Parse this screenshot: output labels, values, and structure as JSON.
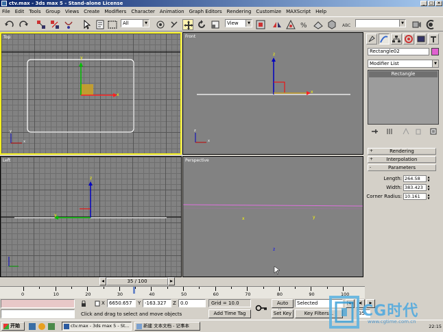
{
  "window": {
    "title": "ctv.max - 3ds max 5 - Stand-alone License"
  },
  "menu": [
    "File",
    "Edit",
    "Tools",
    "Group",
    "Views",
    "Create",
    "Modifiers",
    "Character",
    "Animation",
    "Graph Editors",
    "Rendering",
    "Customize",
    "MAXScript",
    "Help"
  ],
  "toolbar": {
    "selection_filter": "All",
    "ref_coord": "View",
    "named_selection": ""
  },
  "viewports": {
    "top": "Top",
    "front": "Front",
    "left": "Left",
    "perspective": "Perspective"
  },
  "axes": {
    "x": "x",
    "y": "y",
    "z": "z"
  },
  "command_panel": {
    "object_name": "Rectangle02",
    "object_color": "#e060d0",
    "modifier_list": "Modifier List",
    "stack_item": "Rectangle",
    "rollouts": [
      "Rendering",
      "Interpolation",
      "Parameters"
    ],
    "rollout_signs": [
      "+",
      "+",
      "-"
    ],
    "params": {
      "length_label": "Length:",
      "length": "264.58",
      "width_label": "Width:",
      "width": "383.423",
      "corner_label": "Corner Radius:",
      "corner": "10.161"
    }
  },
  "timeline": {
    "slider": "35 / 100",
    "ticks": [
      "0",
      "10",
      "20",
      "30",
      "40",
      "50",
      "60",
      "70",
      "80",
      "90",
      "100"
    ]
  },
  "status": {
    "coords": {
      "x_label": "X",
      "x": "6650.657",
      "y_label": "Y",
      "y": "-163.327",
      "z_label": "Z",
      "z": "0.0"
    },
    "grid": "Grid = 10.0",
    "prompt": "Click and drag to select and move objects",
    "add_time_tag": "Add Time Tag",
    "auto_key": "Auto Key",
    "set_key": "Set Key",
    "key_mode": "Selected",
    "key_filters": "Key Filters...",
    "frame": "35"
  },
  "taskbar": {
    "start": "开始",
    "tasks": [
      "ctv.max - 3ds max 5 - St...",
      "新建 文本文档 - 记事本"
    ],
    "clock": "22:15"
  },
  "watermark": {
    "brand": "CG时代",
    "url": "www.cgtime.com.cn"
  }
}
